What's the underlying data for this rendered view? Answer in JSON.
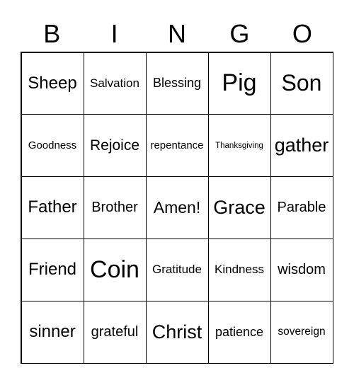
{
  "header": [
    "B",
    "I",
    "N",
    "G",
    "O"
  ],
  "cells": [
    "Sheep",
    "Salvation",
    "Blessing",
    "Pig",
    "Son",
    "Goodness",
    "Rejoice",
    "repentance",
    "Thanksgiving",
    "gather",
    "Father",
    "Brother",
    "Amen!",
    "Grace",
    "Parable",
    "Friend",
    "Coin",
    "Gratitude",
    "Kindness",
    "wisdom",
    "sinner",
    "grateful",
    "Christ",
    "patience",
    "sovereign"
  ]
}
